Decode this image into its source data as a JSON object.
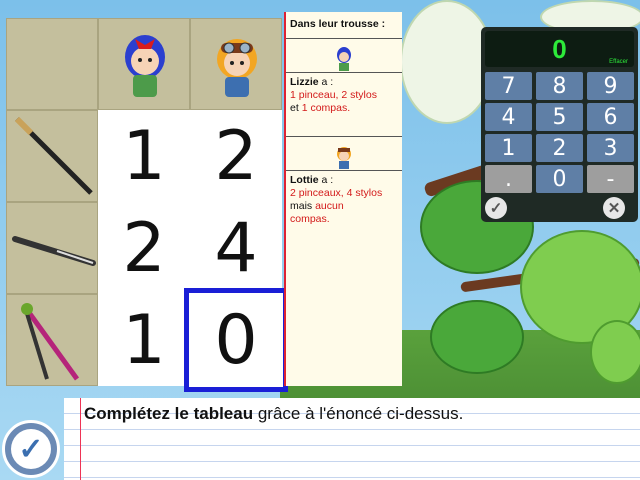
{
  "statement": {
    "header": "Dans leur trousse :",
    "lizzie_name": "Lizzie",
    "lizzie_suffix": " a :",
    "lizzie_line1": "1 pinceau, 2 stylos",
    "lizzie_et": "et ",
    "lizzie_line2": "1 compas.",
    "lottie_name": "Lottie",
    "lottie_suffix": " a :",
    "lottie_line1": "2 pinceaux, 4 stylos",
    "lottie_mais": "mais ",
    "lottie_aucun": "aucun",
    "lottie_line3": "compas."
  },
  "table": {
    "rows": [
      {
        "item_icon": "paintbrush-icon",
        "lizzie": "1",
        "lottie": "2"
      },
      {
        "item_icon": "pen-icon",
        "lizzie": "2",
        "lottie": "4"
      },
      {
        "item_icon": "compass-icon",
        "lizzie": "1",
        "lottie": "0"
      }
    ],
    "selected_cell": "row3-lottie"
  },
  "calculator": {
    "display": "0",
    "clear_label": "Effacer",
    "keys": [
      "7",
      "8",
      "9",
      "4",
      "5",
      "6",
      "1",
      "2",
      "3",
      ".",
      "0",
      "-"
    ],
    "ok_icon": "check-icon",
    "cancel_icon": "cross-icon"
  },
  "instruction": {
    "bold": "Complétez le tableau",
    "rest": " grâce à l'énoncé ci-dessus."
  },
  "validate_icon": "check-icon",
  "colors": {
    "accent_red": "#d31a1a",
    "selection_blue": "#1a1fd6",
    "calc_key": "#5f7fa6",
    "display_green": "#2dea3a"
  }
}
